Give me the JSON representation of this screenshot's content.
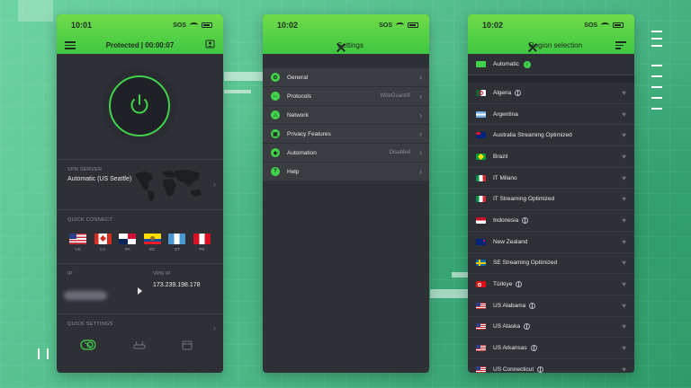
{
  "colors": {
    "accent": "#3fd24a",
    "panel": "#2e3036",
    "topbar": "#5fd84a"
  },
  "home": {
    "time": "10:01",
    "sos": "SOS",
    "status_title": "Protected | 00:00:07",
    "vpn_server_label": "VPN SERVER",
    "vpn_server_value": "Automatic (US Seattle)",
    "quick_connect_label": "QUICK CONNECT",
    "flags": [
      {
        "code": "US"
      },
      {
        "code": "CA"
      },
      {
        "code": "PA"
      },
      {
        "code": "EC"
      },
      {
        "code": "GT"
      },
      {
        "code": "PE"
      }
    ],
    "ip_label": "IP",
    "vpn_ip_label": "VPN IP",
    "vpn_ip_value": "173.239.198.178",
    "quick_settings_label": "QUICK SETTINGS"
  },
  "settings": {
    "time": "10:02",
    "sos": "SOS",
    "title": "Settings",
    "items": [
      {
        "label": "General",
        "value": "",
        "icon": "gear-icon"
      },
      {
        "label": "Protocols",
        "value": "WireGuard®",
        "icon": "protocol-icon"
      },
      {
        "label": "Network",
        "value": "",
        "icon": "network-icon"
      },
      {
        "label": "Privacy Features",
        "value": "",
        "icon": "lock-icon"
      },
      {
        "label": "Automation",
        "value": "Disabled",
        "icon": "automation-icon"
      },
      {
        "label": "Help",
        "value": "",
        "icon": "help-icon"
      }
    ]
  },
  "regions": {
    "time": "10:02",
    "sos": "SOS",
    "title": "Region selection",
    "automatic_label": "Automatic",
    "items": [
      {
        "label": "Algeria",
        "globe": true
      },
      {
        "label": "Argentina",
        "globe": false
      },
      {
        "label": "Australia Streaming Optimized",
        "globe": false
      },
      {
        "label": "Brazil",
        "globe": false
      },
      {
        "label": "IT Milano",
        "globe": false
      },
      {
        "label": "IT Streaming Optimized",
        "globe": false
      },
      {
        "label": "Indonesia",
        "globe": true
      },
      {
        "label": "New Zealand",
        "globe": false
      },
      {
        "label": "SE Streaming Optimized",
        "globe": false
      },
      {
        "label": "Türkiye",
        "globe": true
      },
      {
        "label": "US Alabama",
        "globe": true
      },
      {
        "label": "US Alaska",
        "globe": true
      },
      {
        "label": "US Arkansas",
        "globe": true
      },
      {
        "label": "US Connecticut",
        "globe": true
      }
    ]
  }
}
